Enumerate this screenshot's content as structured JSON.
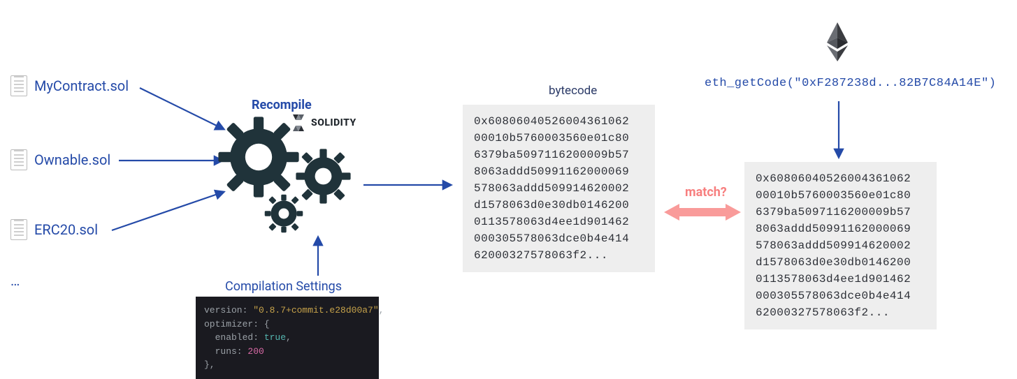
{
  "files": [
    {
      "label": "MyContract.sol"
    },
    {
      "label": "Ownable.sol"
    },
    {
      "label": "ERC20.sol"
    }
  ],
  "files_ellipsis": "…",
  "recompile_label": "Recompile",
  "solidity_label": "SOLIDITY",
  "bytecode_label": "bytecode",
  "bytecode_lines": [
    "0x60806040526004361062",
    "00010b5760003560e01c80",
    "6379ba5097116200009b57",
    "8063addd50991162000069",
    "578063addd509914620002",
    "d1578063d0e30db0146200",
    "0113578063d4ee1d901462",
    "000305578063dce0b4e414",
    "62000327578063f2..."
  ],
  "onchain_lines": [
    "0x60806040526004361062",
    "00010b5760003560e01c80",
    "6379ba5097116200009b57",
    "8063addd50991162000069",
    "578063addd509914620002",
    "d1578063d0e30db0146200",
    "0113578063d4ee1d901462",
    "000305578063dce0b4e414",
    "62000327578063f2..."
  ],
  "match_label": "match?",
  "eth_getcode": "eth_getCode(\"0xF287238d...82B7C84A14E\")",
  "settings_label": "Compilation Settings",
  "settings": {
    "line1_key": "version: ",
    "line1_val": "\"0.8.7+commit.e28d00a7\"",
    "line1_comma": ",",
    "line2": "optimizer: {",
    "line3_key": "  enabled: ",
    "line3_val": "true",
    "line3_comma": ",",
    "line4_key": "  runs: ",
    "line4_val": "200",
    "line5": "},"
  }
}
